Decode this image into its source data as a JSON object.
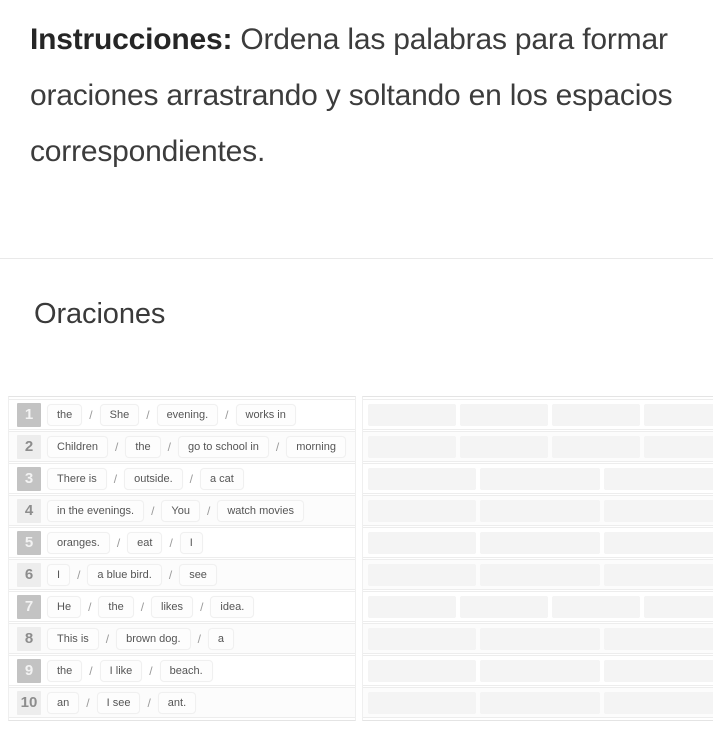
{
  "instructions": {
    "lead": "Instrucciones:",
    "body": " Ordena las palabras para formar oraciones arrastrando y soltando en los espacios correspondientes."
  },
  "section": {
    "title": "Oraciones"
  },
  "colors": {
    "badge_odd_bg": "#c3c3c3",
    "badge_odd_text": "#f3f3f3",
    "badge_even_bg": "#ededed",
    "badge_even_text": "#8d8d8d",
    "chip_bg": "#fdfdfd",
    "chip_border": "#f0f0f0",
    "chip_text": "#555555",
    "dropzone_bg": "#f4f4f4",
    "row_border": "#ededed",
    "divider": "#e9e9e9",
    "text_primary": "#3c3c3c"
  },
  "separator": "/",
  "sentences": [
    {
      "number": "1",
      "words": [
        "the",
        "She",
        "evening.",
        "works in"
      ],
      "drop_count": 4
    },
    {
      "number": "2",
      "words": [
        "Children",
        "the",
        "go to school in",
        "morning"
      ],
      "drop_count": 4
    },
    {
      "number": "3",
      "words": [
        "There is",
        "outside.",
        "a cat"
      ],
      "drop_count": 3
    },
    {
      "number": "4",
      "words": [
        "in the evenings.",
        "You",
        "watch movies"
      ],
      "drop_count": 3
    },
    {
      "number": "5",
      "words": [
        "oranges.",
        "eat",
        "I"
      ],
      "drop_count": 3
    },
    {
      "number": "6",
      "words": [
        "I",
        "a blue bird.",
        "see"
      ],
      "drop_count": 3
    },
    {
      "number": "7",
      "words": [
        "He",
        "the",
        "likes",
        "idea."
      ],
      "drop_count": 4
    },
    {
      "number": "8",
      "words": [
        "This is",
        "brown dog.",
        "a"
      ],
      "drop_count": 3
    },
    {
      "number": "9",
      "words": [
        "the",
        "I like",
        "beach."
      ],
      "drop_count": 3
    },
    {
      "number": "10",
      "words": [
        "an",
        "I see",
        "ant."
      ],
      "drop_count": 3
    }
  ]
}
